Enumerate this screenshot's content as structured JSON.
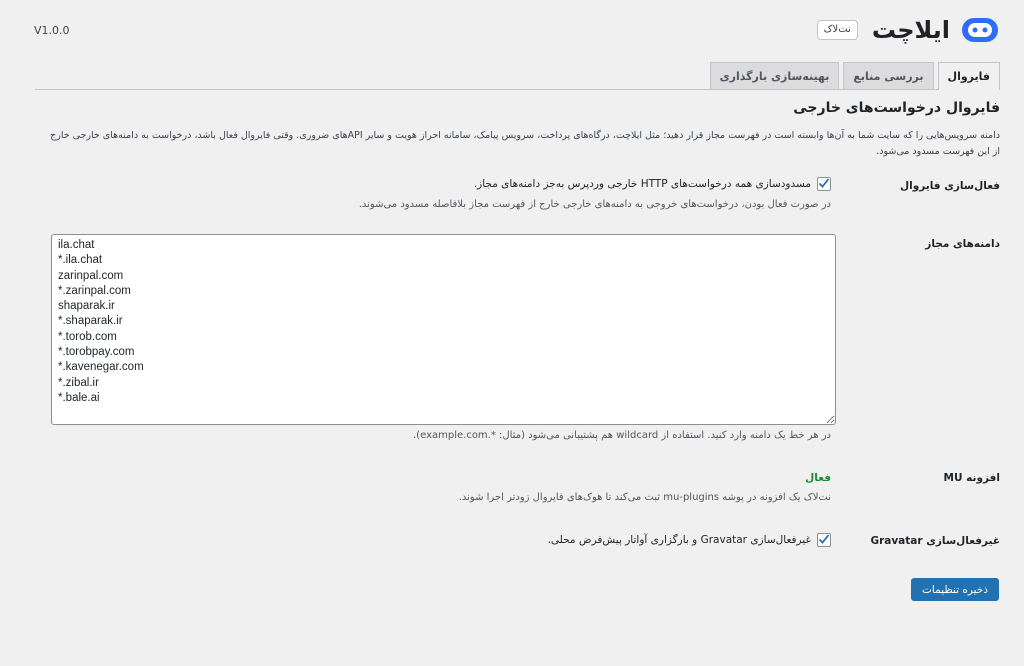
{
  "header": {
    "brand_name": "ایلاچت",
    "badge": "نت‌لاک",
    "version": "V1.0.0",
    "accent_color": "#2f6df6"
  },
  "tabs": [
    {
      "label": "فایروال",
      "active": true
    },
    {
      "label": "بررسی منابع",
      "active": false
    },
    {
      "label": "بهینه‌سازی بارگذاری",
      "active": false
    }
  ],
  "section": {
    "title": "فایروال درخواست‌های خارجی",
    "description": "دامنه سرویس‌هایی را که سایت شما به آن‌ها وابسته است در فهرست مجاز قرار دهید؛ مثل ایلاچت، درگاه‌های پرداخت، سرویس پیامک، سامانه احراز هویت و سایر APIهای ضروری. وقتی فایروال فعال باشد، درخواست به دامنه‌های خارجی خارج از این فهرست مسدود می‌شود."
  },
  "firewall": {
    "label": "فعال‌سازی فایروال",
    "checkbox_label": "مسدودسازی همه درخواست‌های HTTP خارجی وردپرس به‌جز دامنه‌های مجاز.",
    "checked": true,
    "help": "در صورت فعال بودن، درخواست‌های خروجی به دامنه‌های خارجی خارج از فهرست مجاز بلافاصله مسدود می‌شوند."
  },
  "allowed_domains": {
    "label": "دامنه‌های مجاز",
    "value": "ila.chat\n*.ila.chat\nzarinpal.com\n*.zarinpal.com\nshaparak.ir\n*.shaparak.ir\n*.torob.com\n*.torobpay.com\n*.kavenegar.com\n*.zibal.ir\n*.bale.ai",
    "help": "در هر خط یک دامنه وارد کنید. استفاده از wildcard هم پشتیبانی می‌شود (مثال: *.example.com)."
  },
  "mu_plugin": {
    "label": "افزونه MU",
    "status": "فعال",
    "status_color": "#1d8a37",
    "help": "نت‌لاک یک افزونه در پوشه mu-plugins ثبت می‌کند تا هوک‌های فایروال زودتر اجرا شوند."
  },
  "gravatar": {
    "label": "غیرفعال‌سازی Gravatar",
    "checkbox_label": "غیرفعال‌سازی Gravatar و بارگزاری آواتار پیش‌فرض محلی.",
    "checked": true
  },
  "save_label": "ذخیره تنظیمات"
}
